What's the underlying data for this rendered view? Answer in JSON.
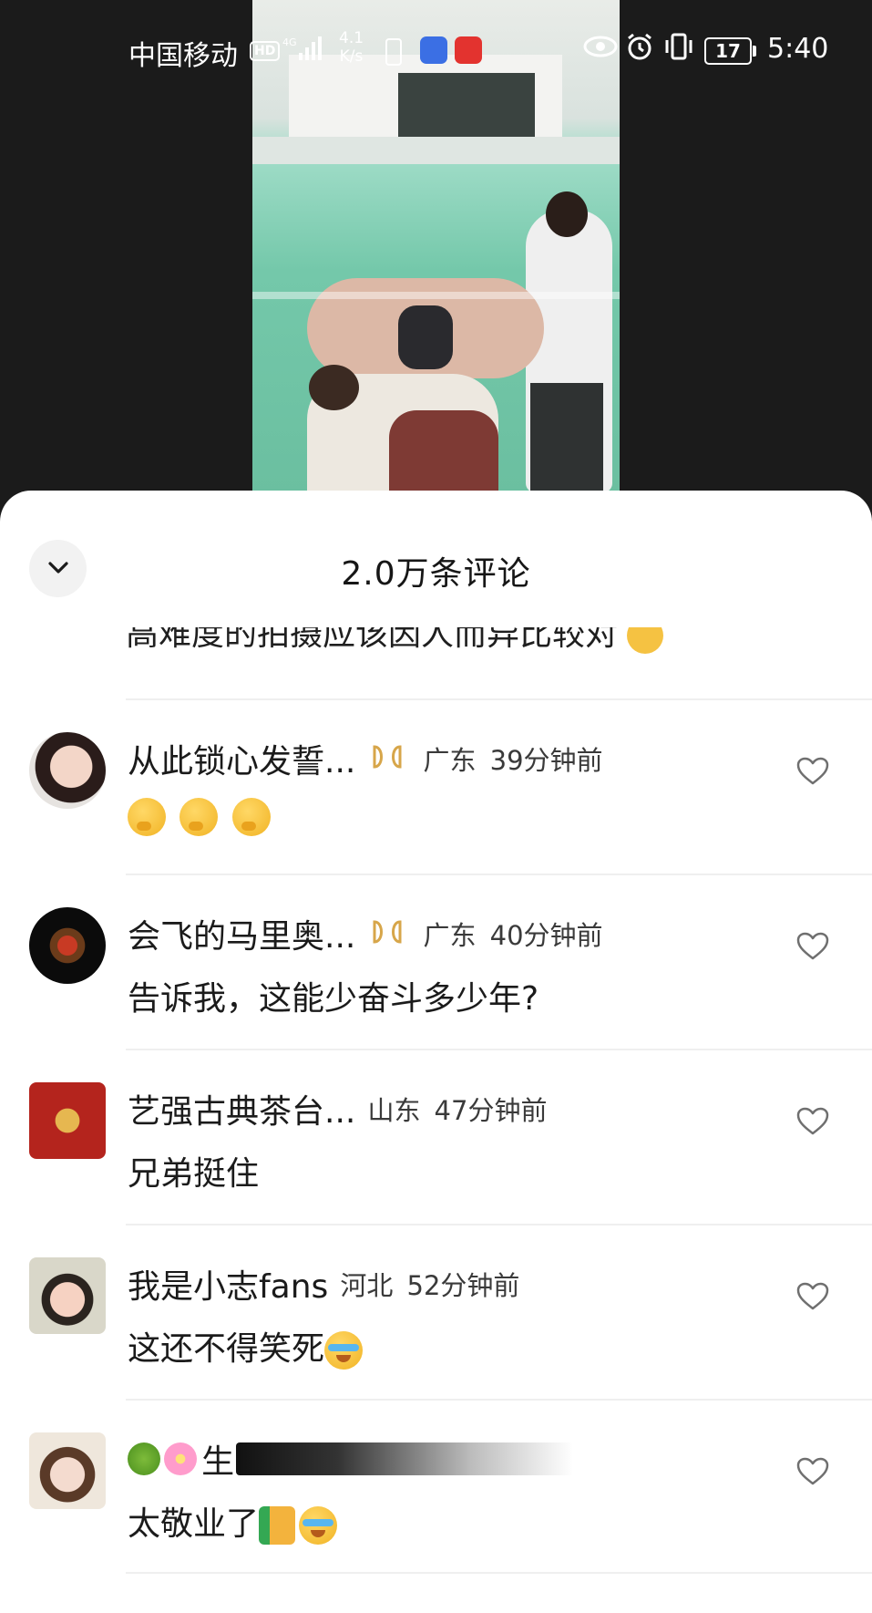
{
  "status_bar": {
    "carrier": "中国移动",
    "hd": "HD",
    "network": "4G",
    "speed_value": "4.1",
    "speed_unit": "K/s",
    "battery": "17",
    "time": "5:40"
  },
  "sheet": {
    "title": "2.0万条评论",
    "clipped_previous_comment": "高难度的拍摄应该因人而异比较对"
  },
  "comments": [
    {
      "username": "从此锁心发誓...",
      "has_badge": true,
      "location": "广东",
      "time": "39分钟前",
      "text": "",
      "emojis": [
        "thinking-emoji",
        "thinking-emoji",
        "thinking-emoji"
      ]
    },
    {
      "username": "会飞的马里奥...",
      "has_badge": true,
      "location": "广东",
      "time": "40分钟前",
      "text": "告诉我，这能少奋斗多少年?"
    },
    {
      "username": "艺强古典茶台...",
      "has_badge": false,
      "location": "山东",
      "time": "47分钟前",
      "text": "兄弟挺住"
    },
    {
      "username": "我是小志fans",
      "has_badge": false,
      "location": "河北",
      "time": "52分钟前",
      "text": "这还不得笑死",
      "emojis": [
        "laughing-crying-emoji"
      ]
    },
    {
      "username": "生",
      "has_badge": false,
      "location": "",
      "time": "",
      "text": "太敬业了",
      "emojis": [
        "thumbs-up-emoji",
        "laughing-crying-emoji"
      ]
    }
  ],
  "colors": {
    "badge_gold": "#d7a64a",
    "heart_stroke": "#6f6f6f",
    "sheet_bg": "#ffffff",
    "backdrop": "#1b1b1b"
  }
}
